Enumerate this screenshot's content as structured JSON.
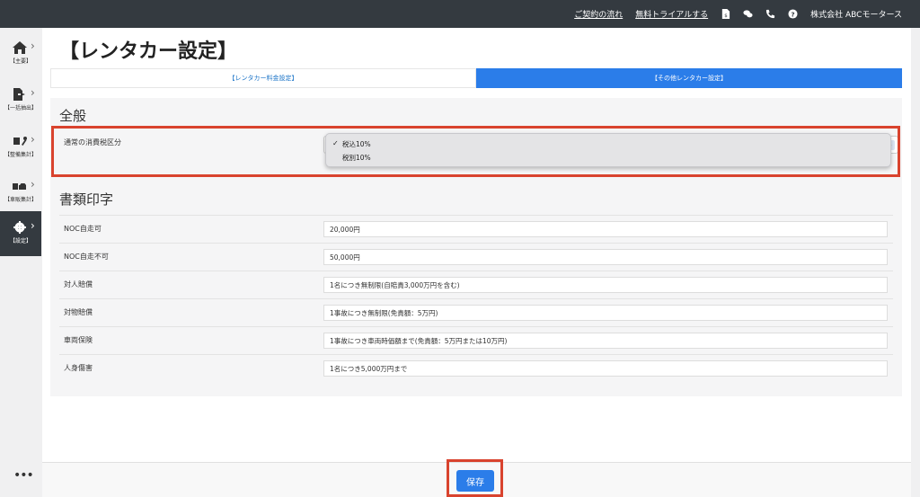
{
  "topbar": {
    "link_flow": "ご契約の流れ",
    "link_trial": "無料トライアルする",
    "company": "株式会社 ABCモータース",
    "icons": [
      "document-yen-icon",
      "chat-icon",
      "phone-icon",
      "help-icon"
    ]
  },
  "sidebar": {
    "items": [
      {
        "label": "【主要】",
        "icon": "home-icon"
      },
      {
        "label": "【一括抽出】",
        "icon": "file-export-icon"
      },
      {
        "label": "【整備集計】",
        "icon": "tools-icon"
      },
      {
        "label": "【車販集計】",
        "icon": "car-icon"
      },
      {
        "label": "【設定】",
        "icon": "gear-icon",
        "active": true
      }
    ],
    "more": "•••"
  },
  "page": {
    "title": "【レンタカー設定】",
    "tabs": [
      {
        "label": "【レンタカー料金設定】",
        "active": false
      },
      {
        "label": "【その他レンタカー設定】",
        "active": true
      }
    ]
  },
  "general": {
    "title": "全般",
    "tax_label": "通常の消費税区分",
    "tax_options": [
      "税込10%",
      "税別10%"
    ],
    "tax_selected": "税込10%"
  },
  "documents": {
    "title": "書類印字",
    "rows": [
      {
        "label": "NOC自走可",
        "value": "20,000円"
      },
      {
        "label": "NOC自走不可",
        "value": "50,000円"
      },
      {
        "label": "対人賠償",
        "value": "1名につき無制限(自賠責3,000万円を含む)"
      },
      {
        "label": "対物賠償",
        "value": "1事故につき無制限(免責額：5万円)"
      },
      {
        "label": "車両保険",
        "value": "1事故につき車両時価額まで(免責額：5万円または10万円)"
      },
      {
        "label": "人身傷害",
        "value": "1名につき5,000万円まで"
      }
    ]
  },
  "footer": {
    "save_label": "保存"
  },
  "colors": {
    "accent": "#2b7de9",
    "highlight": "#d9432e",
    "topbar": "#343a40"
  }
}
